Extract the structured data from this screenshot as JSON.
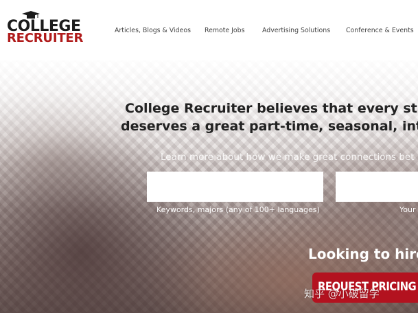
{
  "header": {
    "logo": {
      "line1": "COLLEGE",
      "line2": "RECRUITER"
    },
    "nav": [
      {
        "label": "Articles, Blogs & Videos"
      },
      {
        "label": "Remote Jobs"
      },
      {
        "label": "Advertising Solutions"
      },
      {
        "label": "Conference & Events"
      }
    ]
  },
  "hero": {
    "headline_line1": "College Recruiter believes that every stu",
    "headline_line2": "deserves a great part-time, seasonal, int",
    "subtitle": "Learn more about how we make great connections bet",
    "search": {
      "keywords_value": "",
      "keywords_caption": "Keywords, majors (any of 100+ languages)",
      "location_value": "",
      "location_caption": "Your"
    },
    "hire_text": "Looking to hire",
    "pricing_button": "REQUEST PRICING"
  },
  "watermark": "知乎 @小破留学",
  "colors": {
    "brand_red": "#b3121f",
    "logo_red": "#b01b1b",
    "nav_text": "#444444",
    "headline_text": "#222222"
  }
}
